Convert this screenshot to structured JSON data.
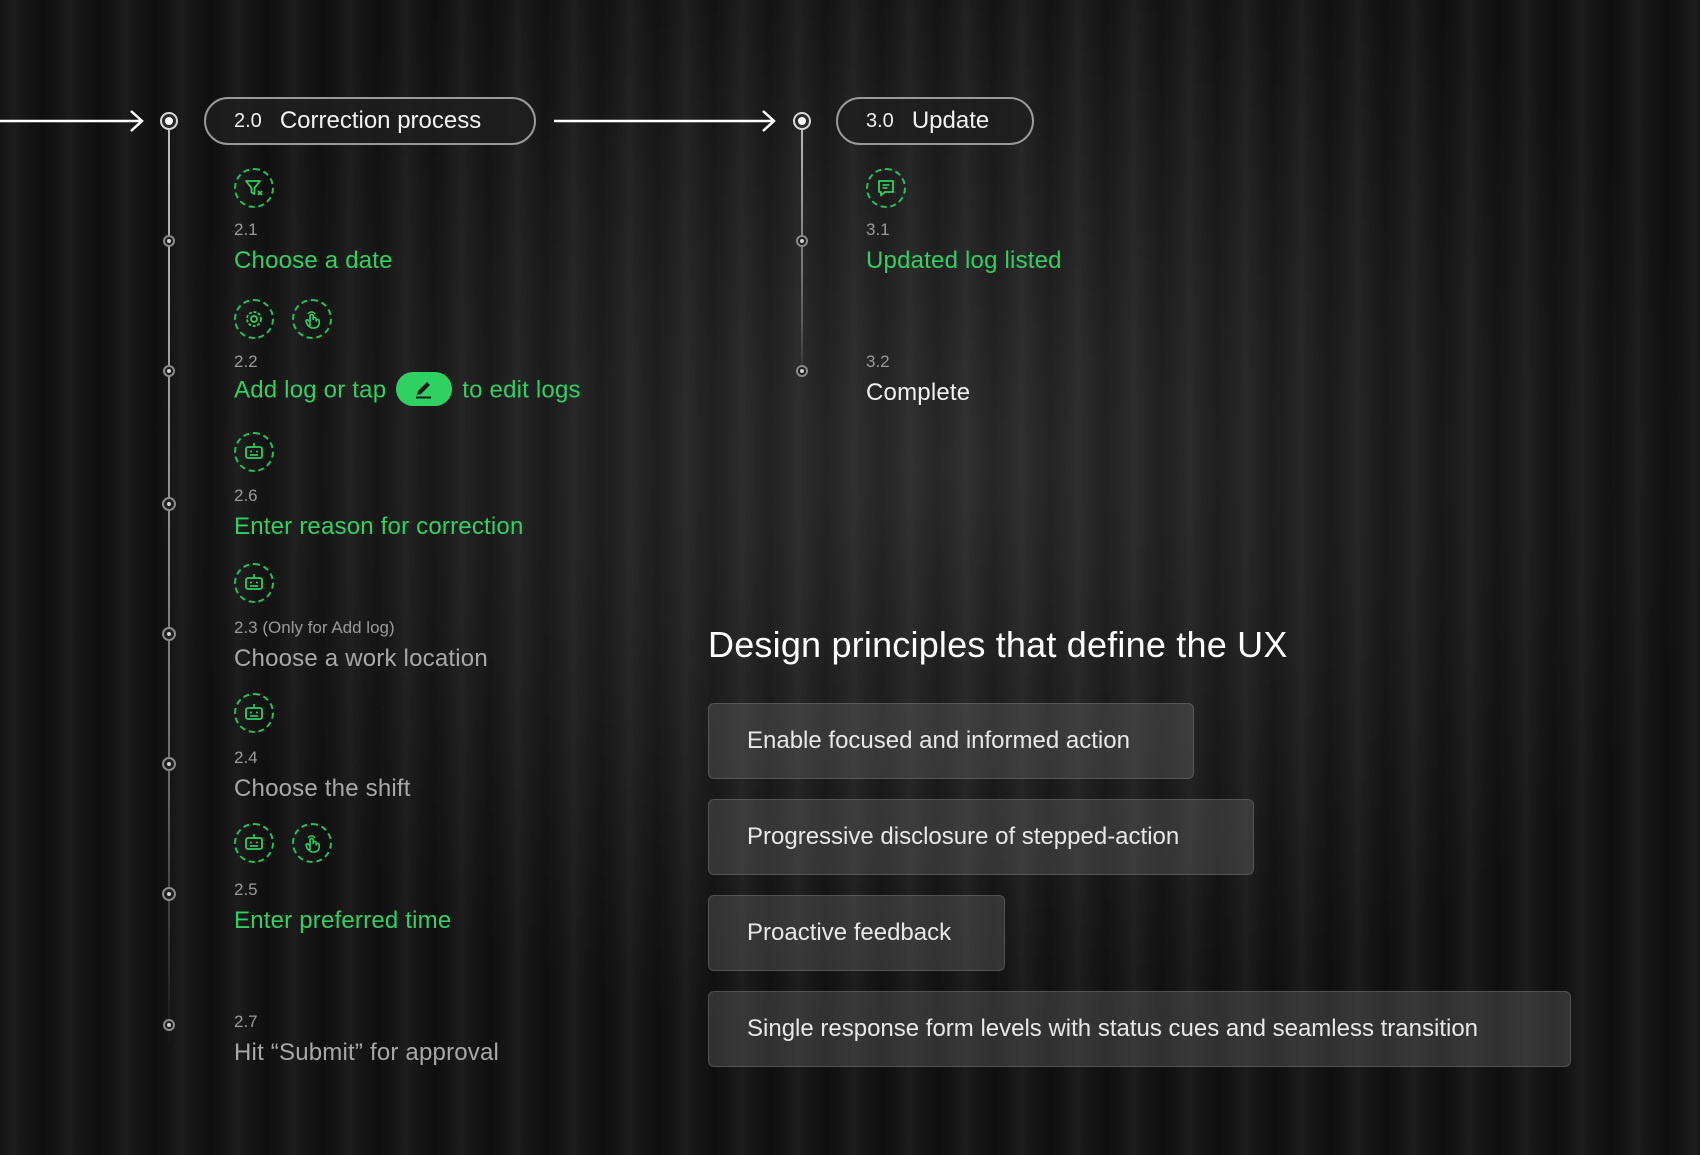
{
  "phase2": {
    "number": "2.0",
    "title": "Correction process",
    "steps": [
      {
        "id": "2.1",
        "label": "Choose a date",
        "icons": [
          "filter-icon"
        ]
      },
      {
        "id": "2.2",
        "label_before": "Add log or tap",
        "label_after": "to edit logs",
        "icons": [
          "settings-icon",
          "tap-icon"
        ],
        "chip_icon": "pencil-icon"
      },
      {
        "id": "2.6",
        "label": "Enter reason for correction",
        "icons": [
          "keyboard-icon"
        ]
      },
      {
        "id": "2.3 (Only for Add log)",
        "label": "Choose a work location",
        "icons": [
          "keyboard-icon"
        ]
      },
      {
        "id": "2.4",
        "label": "Choose the shift",
        "icons": [
          "keyboard-icon"
        ]
      },
      {
        "id": "2.5",
        "label": "Enter preferred time",
        "icons": [
          "keyboard-icon",
          "tap-icon"
        ]
      },
      {
        "id": "2.7",
        "label": "Hit “Submit” for approval"
      }
    ]
  },
  "phase3": {
    "number": "3.0",
    "title": "Update",
    "steps": [
      {
        "id": "3.1",
        "label": "Updated log listed",
        "icons": [
          "message-icon"
        ]
      },
      {
        "id": "3.2",
        "label": "Complete"
      }
    ]
  },
  "principles": {
    "heading": "Design principles that define the UX",
    "items": [
      "Enable focused and informed action",
      "Progressive disclosure of stepped-action",
      "Proactive feedback",
      "Single response form levels with status cues and seamless transition"
    ]
  },
  "colors": {
    "accent_green": "#2fd262",
    "muted_text": "#a8a8a8",
    "background": "#141414"
  }
}
